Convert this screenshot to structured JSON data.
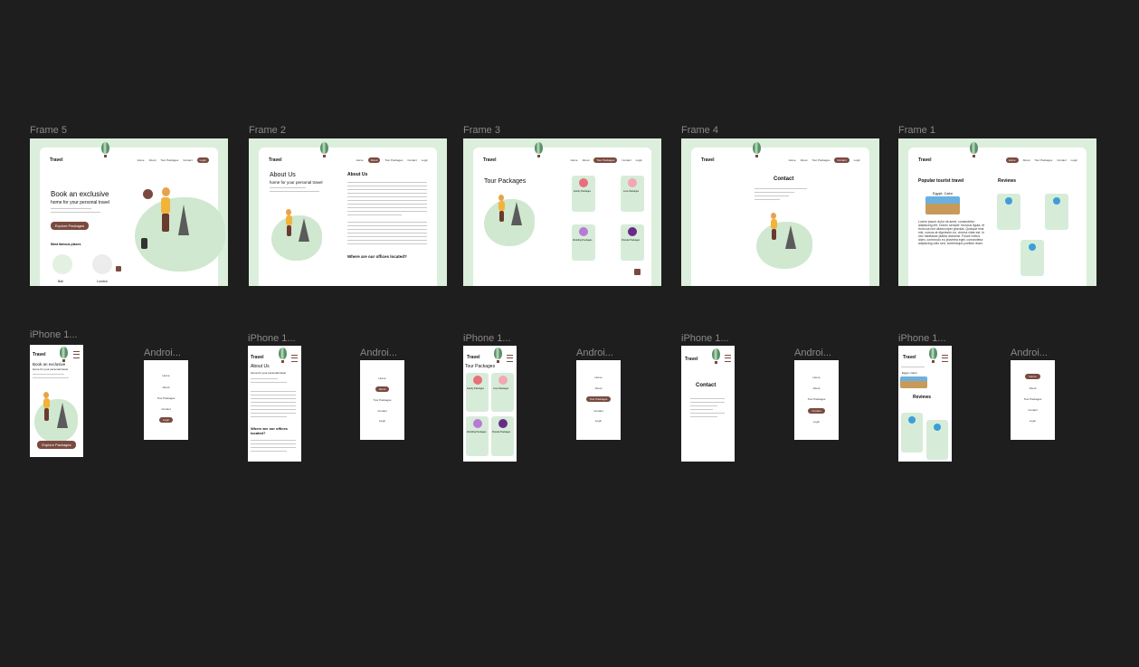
{
  "canvas": {
    "background": "#1e1e1e",
    "accent": "#7a4a40",
    "mint": "#dcefdc"
  },
  "frames": [
    {
      "label": "Frame 5",
      "brand": "Travel",
      "nav": [
        "Home",
        "About",
        "Tour Packages",
        "Contact",
        "Login"
      ],
      "hero_title": "Book an exclusive",
      "hero_sub": "home for your personal travel",
      "cta": "Explore Packages",
      "places_heading": "Most famous places",
      "places": [
        "Bali",
        "London"
      ]
    },
    {
      "label": "Frame 2",
      "brand": "Travel",
      "nav": [
        "Home",
        "About",
        "Tour Packages",
        "Contact",
        "Login"
      ],
      "title": "About Us",
      "subtitle": "home for your personal travel",
      "side_title": "About Us",
      "offices": "Where are our offices located?"
    },
    {
      "label": "Frame 3",
      "brand": "Travel",
      "nav": [
        "Home",
        "About",
        "Tour Packages",
        "Contact",
        "Login"
      ],
      "title": "Tour Packages",
      "packages": [
        "Family Packages",
        "Love Packages",
        "Wedding Packages",
        "Popular Packages"
      ]
    },
    {
      "label": "Frame 4",
      "brand": "Travel",
      "nav": [
        "Home",
        "About",
        "Tour Packages",
        "Contact",
        "Login"
      ],
      "title": "Contact"
    },
    {
      "label": "Frame 1",
      "brand": "Travel",
      "nav": [
        "Home",
        "About",
        "Tour Packages",
        "Contact",
        "Login"
      ],
      "popular": "Popular tourist travel",
      "city": "Egypt, Cairo",
      "lorem": "Lorem ipsum dolor sit amet, consectetur adipiscing elit. Donec semper rhoncus ligula, et rhoncus nisi ullamcorper gravida. Quisque erat nisl, cursus at dignissim eu, viverra vitae est. In nec habitasse platea dictumst. Fusce metus diam, commodo eu pharetra eget, consectetur adipiscing odio sed, scelerisque porttitor diam.",
      "reviews": "Reviews"
    }
  ],
  "mobile": {
    "labels": [
      "iPhone 1...",
      "Androi...",
      "iPhone 1...",
      "Androi...",
      "iPhone 1...",
      "Androi...",
      "iPhone 1...",
      "Androi...",
      "iPhone 1...",
      "Androi..."
    ],
    "brand": "Travel",
    "phone1_title": "Book an exclusive",
    "phone1_sub": "home for your personal travel",
    "phone1_cta": "Explore Packages",
    "phone2_title": "About Us",
    "phone2_sub": "home for your personal travel",
    "phone2_offices": "Where are our offices located?",
    "phone3_title": "Tour Packages",
    "phone3_packages": [
      "Family Packages",
      "Love Packages",
      "Wedding Packages",
      "Popular Packages"
    ],
    "phone4_title": "Contact",
    "phone5_city": "Egypt, Cairo",
    "phone5_reviews": "Reviews",
    "menu": [
      "Home",
      "About",
      "Tour Packages",
      "Contact",
      "Login"
    ]
  }
}
